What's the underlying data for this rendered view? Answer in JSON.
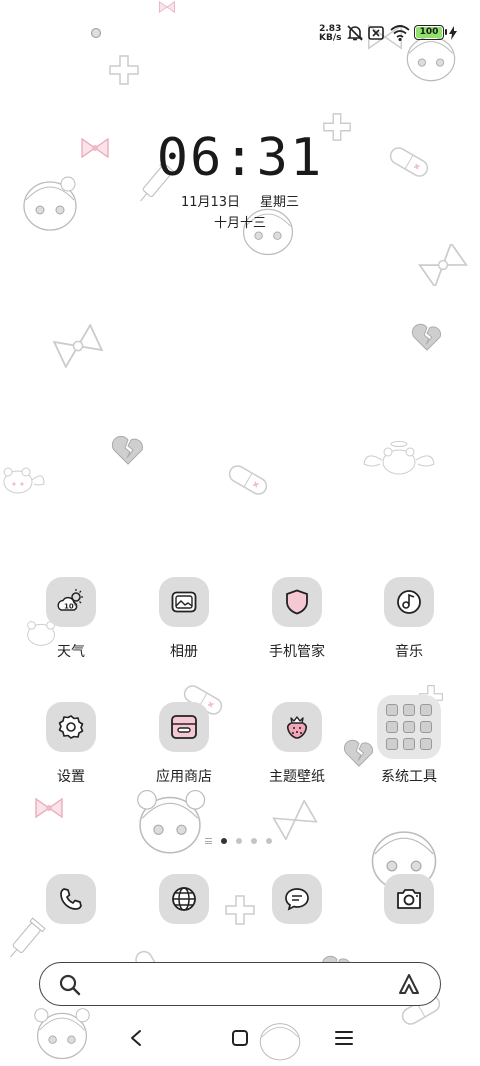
{
  "status_bar": {
    "net_speed_value": "2.83",
    "net_speed_unit": "KB/s",
    "battery_level": "100",
    "battery_color": "#8fe36a"
  },
  "lock": {
    "time": "06:31",
    "date": "11月13日",
    "weekday": "星期三",
    "lunar": "十月十三"
  },
  "apps": [
    {
      "label": "天气",
      "icon": "weather-icon",
      "temp": "10°"
    },
    {
      "label": "相册",
      "icon": "gallery-icon"
    },
    {
      "label": "手机管家",
      "icon": "shield-icon"
    },
    {
      "label": "音乐",
      "icon": "music-icon"
    },
    {
      "label": "设置",
      "icon": "gear-icon"
    },
    {
      "label": "应用商店",
      "icon": "store-icon"
    },
    {
      "label": "主题壁纸",
      "icon": "strawberry-icon"
    },
    {
      "label": "系统工具",
      "icon": "folder-icon"
    }
  ],
  "pager": {
    "pages": 4,
    "active": 1
  },
  "dock": [
    {
      "icon": "phone-icon"
    },
    {
      "icon": "browser-icon"
    },
    {
      "icon": "messages-icon"
    },
    {
      "icon": "camera-icon"
    }
  ],
  "search": {
    "placeholder": ""
  },
  "colors": {
    "icon_bg": "#dcdcdc",
    "accent_pink": "#f2b8c6"
  }
}
